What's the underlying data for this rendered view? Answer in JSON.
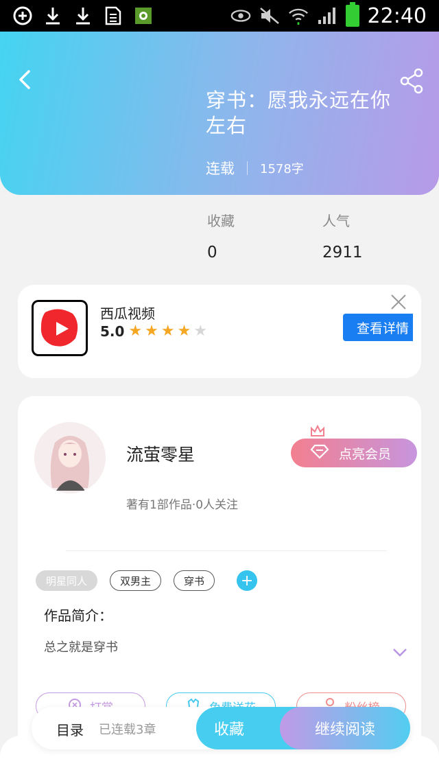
{
  "status_bar": {
    "time": "22:40",
    "icons": [
      "add-circle-icon",
      "download-icon",
      "download-icon",
      "sim-card-icon",
      "app-icon",
      "eye-icon",
      "mute-icon",
      "wifi-icon",
      "signal-icon",
      "battery-icon"
    ]
  },
  "header": {
    "title": "穿书：愿我永远在你左右",
    "status": "连载",
    "word_count": "1578字",
    "icons": [
      "back-icon",
      "share-icon"
    ]
  },
  "stats": [
    {
      "label": "收藏",
      "value": "0"
    },
    {
      "label": "人气",
      "value": "2911"
    }
  ],
  "ad": {
    "app_name": "西瓜视频",
    "score": "5.0",
    "stars_rating": 4,
    "stars_total": 5,
    "button": "查看详情"
  },
  "author": {
    "name": "流萤零星",
    "meta": "著有1部作品·0人关注",
    "vip_button": "点亮会员"
  },
  "tags": [
    "明星同人",
    "双男主",
    "穿书"
  ],
  "intro": {
    "label": "作品简介：",
    "text": "总之就是穿书"
  },
  "actions": [
    "打赏",
    "免费送花",
    "粉丝榜"
  ],
  "bottom": {
    "toc": "目录",
    "toc_meta": "已连载3章",
    "favorite": "收藏",
    "read": "继续阅读"
  },
  "colors": {
    "header_start": "#44d4f1",
    "header_end": "#b79ae8",
    "accent_blue": "#46cdf0",
    "ad_button": "#1a7ef3",
    "star": "#f5a623"
  }
}
